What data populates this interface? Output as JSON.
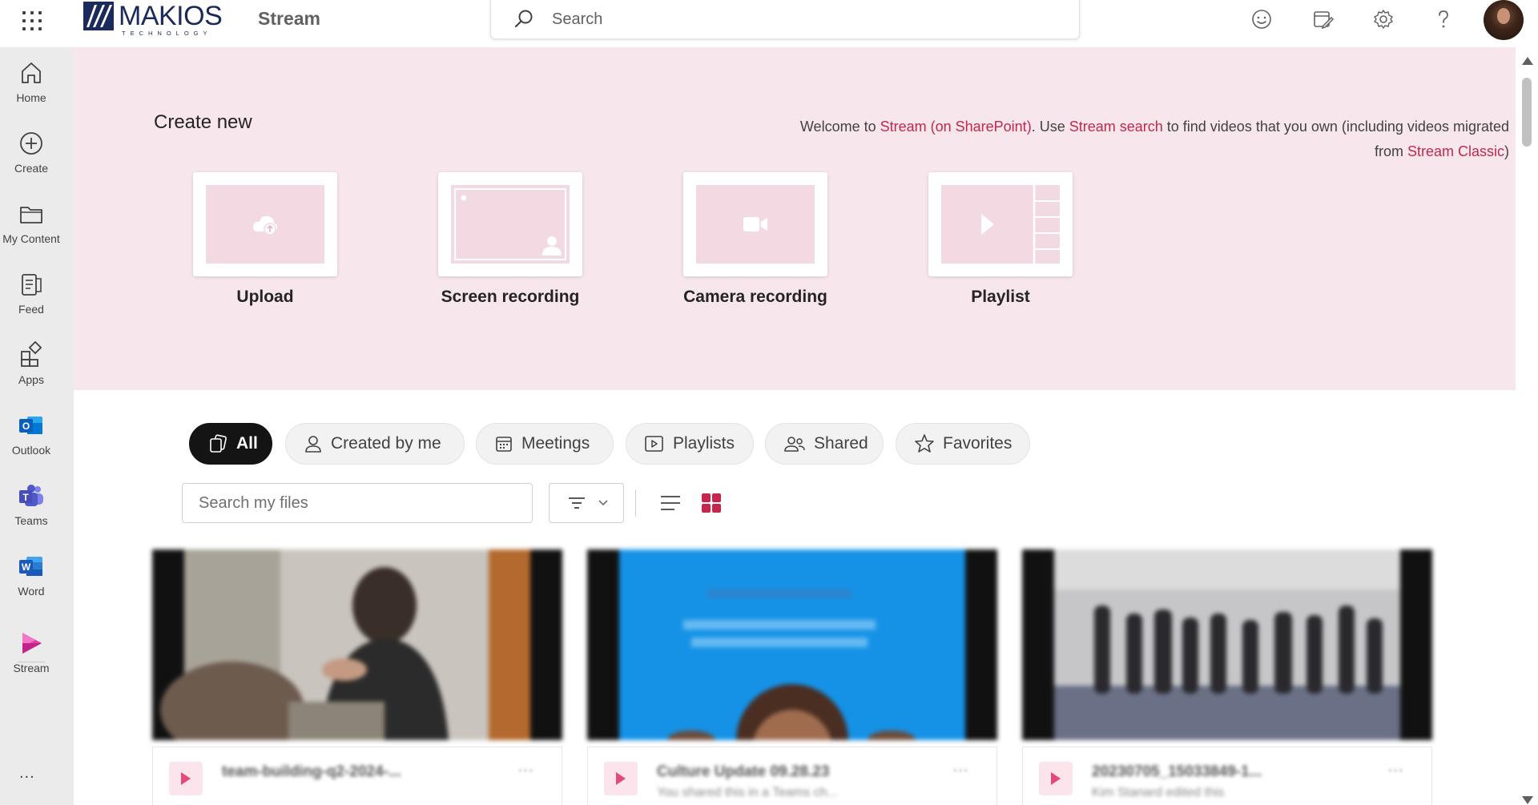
{
  "header": {
    "brand_name": "MAKIOS",
    "brand_sub": "TECHNOLOGY",
    "app_name": "Stream",
    "search_placeholder": "Search",
    "icons": [
      "app-launcher-icon",
      "feedback-smiley-icon",
      "whats-new-icon",
      "settings-gear-icon",
      "help-icon",
      "user-avatar"
    ]
  },
  "rail": {
    "items": [
      {
        "label": "Home",
        "icon": "home-icon"
      },
      {
        "label": "Create",
        "icon": "create-plus-icon"
      },
      {
        "label": "My Content",
        "icon": "folder-icon"
      },
      {
        "label": "Feed",
        "icon": "feed-icon"
      },
      {
        "label": "Apps",
        "icon": "apps-icon"
      },
      {
        "label": "Outlook",
        "icon": "outlook-icon"
      },
      {
        "label": "Teams",
        "icon": "teams-icon"
      },
      {
        "label": "Word",
        "icon": "word-icon"
      },
      {
        "label": "Stream",
        "icon": "stream-icon"
      }
    ],
    "more_label": "..."
  },
  "hero": {
    "title": "Create new",
    "welcome": {
      "p1": "Welcome to ",
      "link1": "Stream (on SharePoint)",
      "p2": ". Use ",
      "link2": "Stream search",
      "p3": " to find videos that you own (including videos migrated from ",
      "link3": "Stream Classic",
      "p4": ")"
    },
    "cards": [
      {
        "label": "Upload",
        "icon": "cloud-upload-icon"
      },
      {
        "label": "Screen recording",
        "icon": "screen-recording-icon"
      },
      {
        "label": "Camera recording",
        "icon": "camera-icon"
      },
      {
        "label": "Playlist",
        "icon": "playlist-icon"
      }
    ]
  },
  "filters": {
    "chips": [
      {
        "label": "All",
        "active": true,
        "icon": "all-files-icon"
      },
      {
        "label": "Created by me",
        "active": false,
        "icon": "person-icon"
      },
      {
        "label": "Meetings",
        "active": false,
        "icon": "calendar-icon"
      },
      {
        "label": "Playlists",
        "active": false,
        "icon": "playlist-icon"
      },
      {
        "label": "Shared",
        "active": false,
        "icon": "people-icon"
      },
      {
        "label": "Favorites",
        "active": false,
        "icon": "star-icon"
      }
    ],
    "search_placeholder": "Search my files"
  },
  "videos": [
    {
      "title": "team-building-q2-2024-...",
      "subtitle": ""
    },
    {
      "title": "Culture Update 09.28.23",
      "subtitle": "You shared this in a Teams ch..."
    },
    {
      "title": "20230705_15033849-1...",
      "subtitle": "Kim Stanard edited this"
    }
  ],
  "colors": {
    "accent": "#c0294b",
    "hero_bg": "#f7e6ec",
    "card_thumb": "#f3d9e2",
    "grid_view_active": "#c4264e",
    "rail_bg": "#ebebeb"
  }
}
